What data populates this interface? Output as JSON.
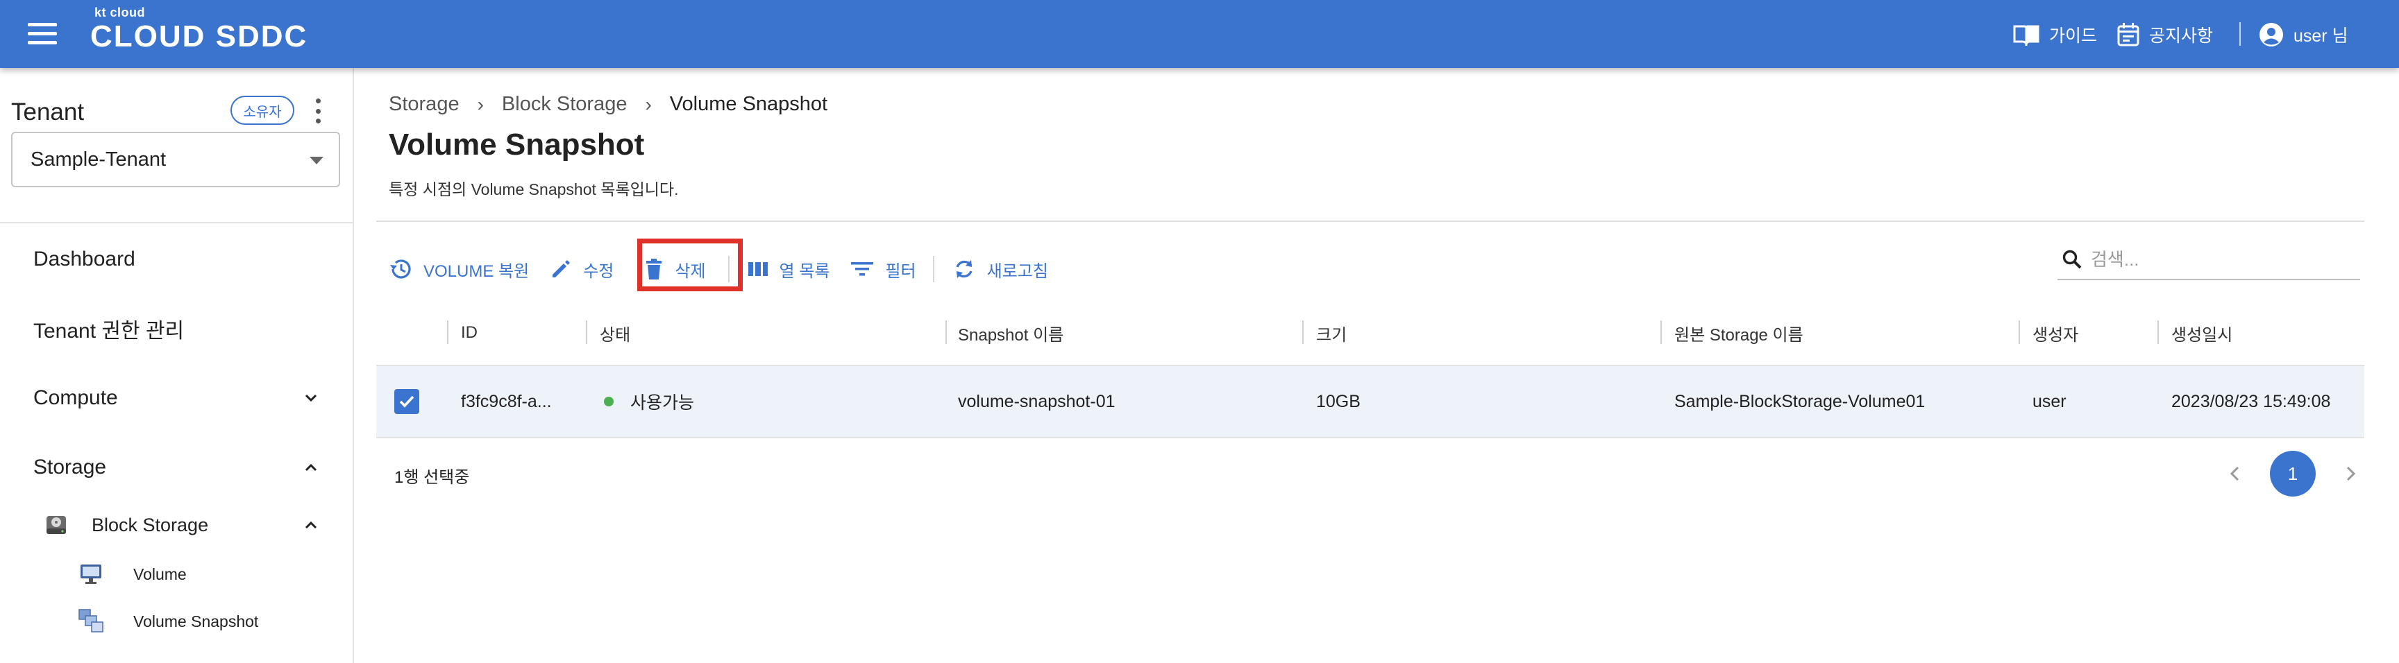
{
  "header": {
    "logo_sub": "kt cloud",
    "logo_main": "CLOUD SDDC",
    "guide_label": "가이드",
    "notice_label": "공지사항",
    "user_label": "user 님"
  },
  "sidebar": {
    "tenant_title": "Tenant",
    "owner_badge": "소유자",
    "tenant_selected": "Sample-Tenant",
    "nav": {
      "dashboard": "Dashboard",
      "tenant_permissions": "Tenant 권한 관리",
      "compute": "Compute",
      "storage": "Storage",
      "block_storage": "Block Storage",
      "volume": "Volume",
      "volume_snapshot": "Volume Snapshot"
    }
  },
  "main": {
    "breadcrumb": [
      "Storage",
      "Block Storage",
      "Volume Snapshot"
    ],
    "title": "Volume Snapshot",
    "description": "특정 시점의 Volume Snapshot 목록입니다.",
    "toolbar": {
      "restore": "VOLUME 복원",
      "edit": "수정",
      "delete": "삭제",
      "columns": "열 목록",
      "filter": "필터",
      "refresh": "새로고침"
    },
    "search": {
      "placeholder": "검색..."
    },
    "table": {
      "headers": [
        "ID",
        "상태",
        "Snapshot 이름",
        "크기",
        "원본 Storage 이름",
        "생성자",
        "생성일시"
      ],
      "rows": [
        {
          "id": "f3fc9c8f-a...",
          "status": "사용가능",
          "snapshot_name": "volume-snapshot-01",
          "size": "10GB",
          "source_storage": "Sample-BlockStorage-Volume01",
          "creator": "user",
          "created_at": "2023/08/23 15:49:08",
          "selected": true
        }
      ]
    },
    "selection_count": "1행 선택중",
    "pagination": {
      "current_page": "1"
    }
  },
  "colors": {
    "primary": "#3a74cf",
    "highlight": "#e03128",
    "status_available": "#4caf50",
    "row_selected_bg": "#eef2f9"
  }
}
